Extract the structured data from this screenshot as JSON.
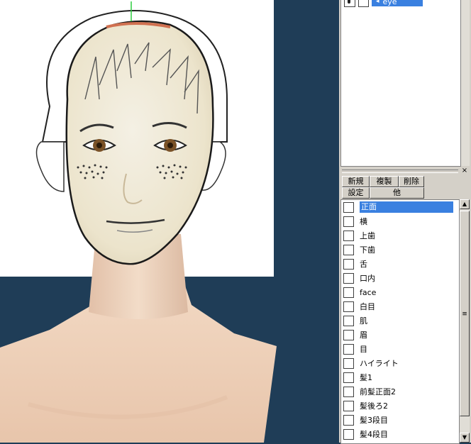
{
  "top_panel": {
    "selected_bone": "eye"
  },
  "material_panel": {
    "close_glyph": "×",
    "buttons": {
      "new": "新規",
      "duplicate": "複製",
      "delete": "削除",
      "settings": "設定",
      "other": "他"
    },
    "materials": [
      {
        "label": "正面",
        "selected": true
      },
      {
        "label": "横",
        "selected": false
      },
      {
        "label": "上歯",
        "selected": false
      },
      {
        "label": "下歯",
        "selected": false
      },
      {
        "label": "舌",
        "selected": false
      },
      {
        "label": "口内",
        "selected": false
      },
      {
        "label": "face",
        "selected": false
      },
      {
        "label": "白目",
        "selected": false
      },
      {
        "label": "肌",
        "selected": false
      },
      {
        "label": "眉",
        "selected": false
      },
      {
        "label": "目",
        "selected": false
      },
      {
        "label": "ハイライト",
        "selected": false
      },
      {
        "label": "髪1",
        "selected": false
      },
      {
        "label": "前髪正面2",
        "selected": false
      },
      {
        "label": "髪後ろ2",
        "selected": false
      },
      {
        "label": "髪3段目",
        "selected": false
      },
      {
        "label": "髪4段目",
        "selected": false
      }
    ],
    "scroll_grip_glyph": "≡"
  },
  "colors": {
    "viewport_bg": "#1f3d57",
    "selection": "#3a80e0",
    "skin": "#efd2ba"
  }
}
